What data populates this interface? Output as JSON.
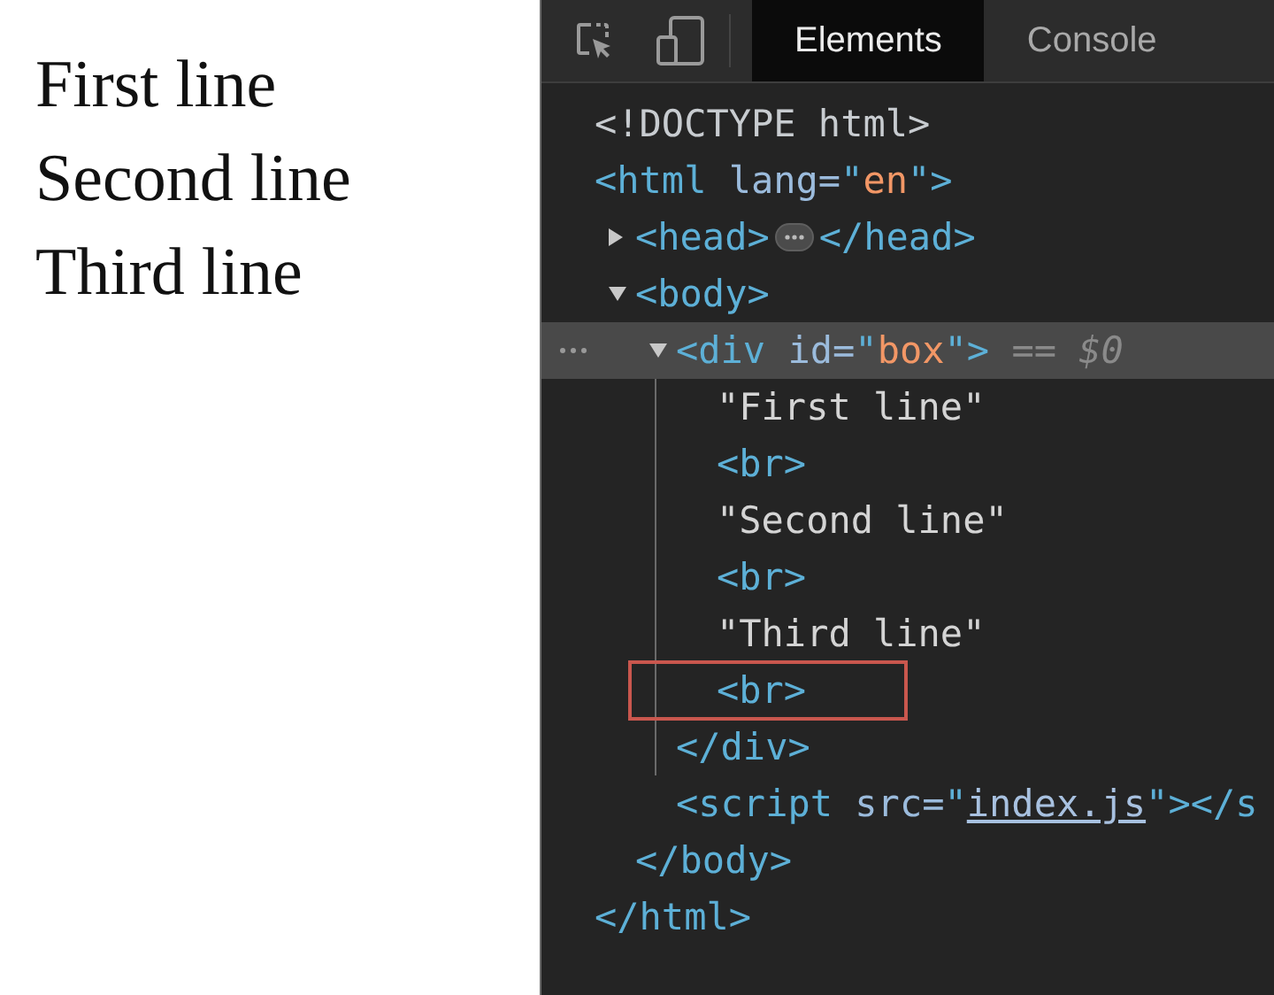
{
  "page": {
    "lines": [
      "First line",
      "Second line",
      "Third line"
    ]
  },
  "devtools": {
    "tabs": [
      {
        "label": "Elements",
        "selected": true
      },
      {
        "label": "Console",
        "selected": false
      }
    ],
    "tree": [
      {
        "tokens": [
          {
            "kind": "doctype",
            "text": "<!DOCTYPE html>"
          }
        ],
        "selected": false,
        "outlined": false
      },
      {
        "tokens": [
          {
            "kind": "tag",
            "text": "<html"
          },
          {
            "kind": "attr",
            "text": " lang="
          },
          {
            "kind": "tag",
            "text": "\""
          },
          {
            "kind": "value",
            "text": "en"
          },
          {
            "kind": "tag",
            "text": "\">"
          }
        ],
        "selected": false,
        "outlined": false,
        "closing": [
          {
            "kind": "tag",
            "text": "</html>"
          }
        ],
        "children": [
          {
            "tokens": [
              {
                "kind": "tag",
                "text": "<head>"
              },
              {
                "kind": "ellipsis"
              },
              {
                "kind": "tag",
                "text": "</head>"
              }
            ],
            "expanded": false,
            "selected": false,
            "outlined": false
          },
          {
            "tokens": [
              {
                "kind": "tag",
                "text": "<body>"
              }
            ],
            "expanded": true,
            "selected": false,
            "outlined": false,
            "closing": [
              {
                "kind": "tag",
                "text": "</body>"
              }
            ],
            "children": [
              {
                "tokens": [
                  {
                    "kind": "tag",
                    "text": "<div"
                  },
                  {
                    "kind": "attr",
                    "text": " id="
                  },
                  {
                    "kind": "tag",
                    "text": "\""
                  },
                  {
                    "kind": "value",
                    "text": "box"
                  },
                  {
                    "kind": "tag",
                    "text": "\">"
                  },
                  {
                    "kind": "marker",
                    "text": " == $0"
                  }
                ],
                "expanded": true,
                "selected": true,
                "outlined": false,
                "closing": [
                  {
                    "kind": "tag",
                    "text": "</div>"
                  }
                ],
                "children": [
                  {
                    "tokens": [
                      {
                        "kind": "text",
                        "text": "\"First line\""
                      }
                    ],
                    "selected": false,
                    "outlined": false
                  },
                  {
                    "tokens": [
                      {
                        "kind": "tag",
                        "text": "<br>"
                      }
                    ],
                    "selected": false,
                    "outlined": false
                  },
                  {
                    "tokens": [
                      {
                        "kind": "text",
                        "text": "\"Second line\""
                      }
                    ],
                    "selected": false,
                    "outlined": false
                  },
                  {
                    "tokens": [
                      {
                        "kind": "tag",
                        "text": "<br>"
                      }
                    ],
                    "selected": false,
                    "outlined": false
                  },
                  {
                    "tokens": [
                      {
                        "kind": "text",
                        "text": "\"Third line\""
                      }
                    ],
                    "selected": false,
                    "outlined": false
                  },
                  {
                    "tokens": [
                      {
                        "kind": "tag",
                        "text": "<br>"
                      }
                    ],
                    "selected": false,
                    "outlined": true
                  }
                ]
              },
              {
                "tokens": [
                  {
                    "kind": "tag",
                    "text": "<script"
                  },
                  {
                    "kind": "attr",
                    "text": " src="
                  },
                  {
                    "kind": "tag",
                    "text": "\""
                  },
                  {
                    "kind": "link",
                    "text": "index.js"
                  },
                  {
                    "kind": "tag",
                    "text": "\"></s"
                  }
                ],
                "selected": false,
                "outlined": false
              }
            ]
          }
        ]
      }
    ]
  }
}
